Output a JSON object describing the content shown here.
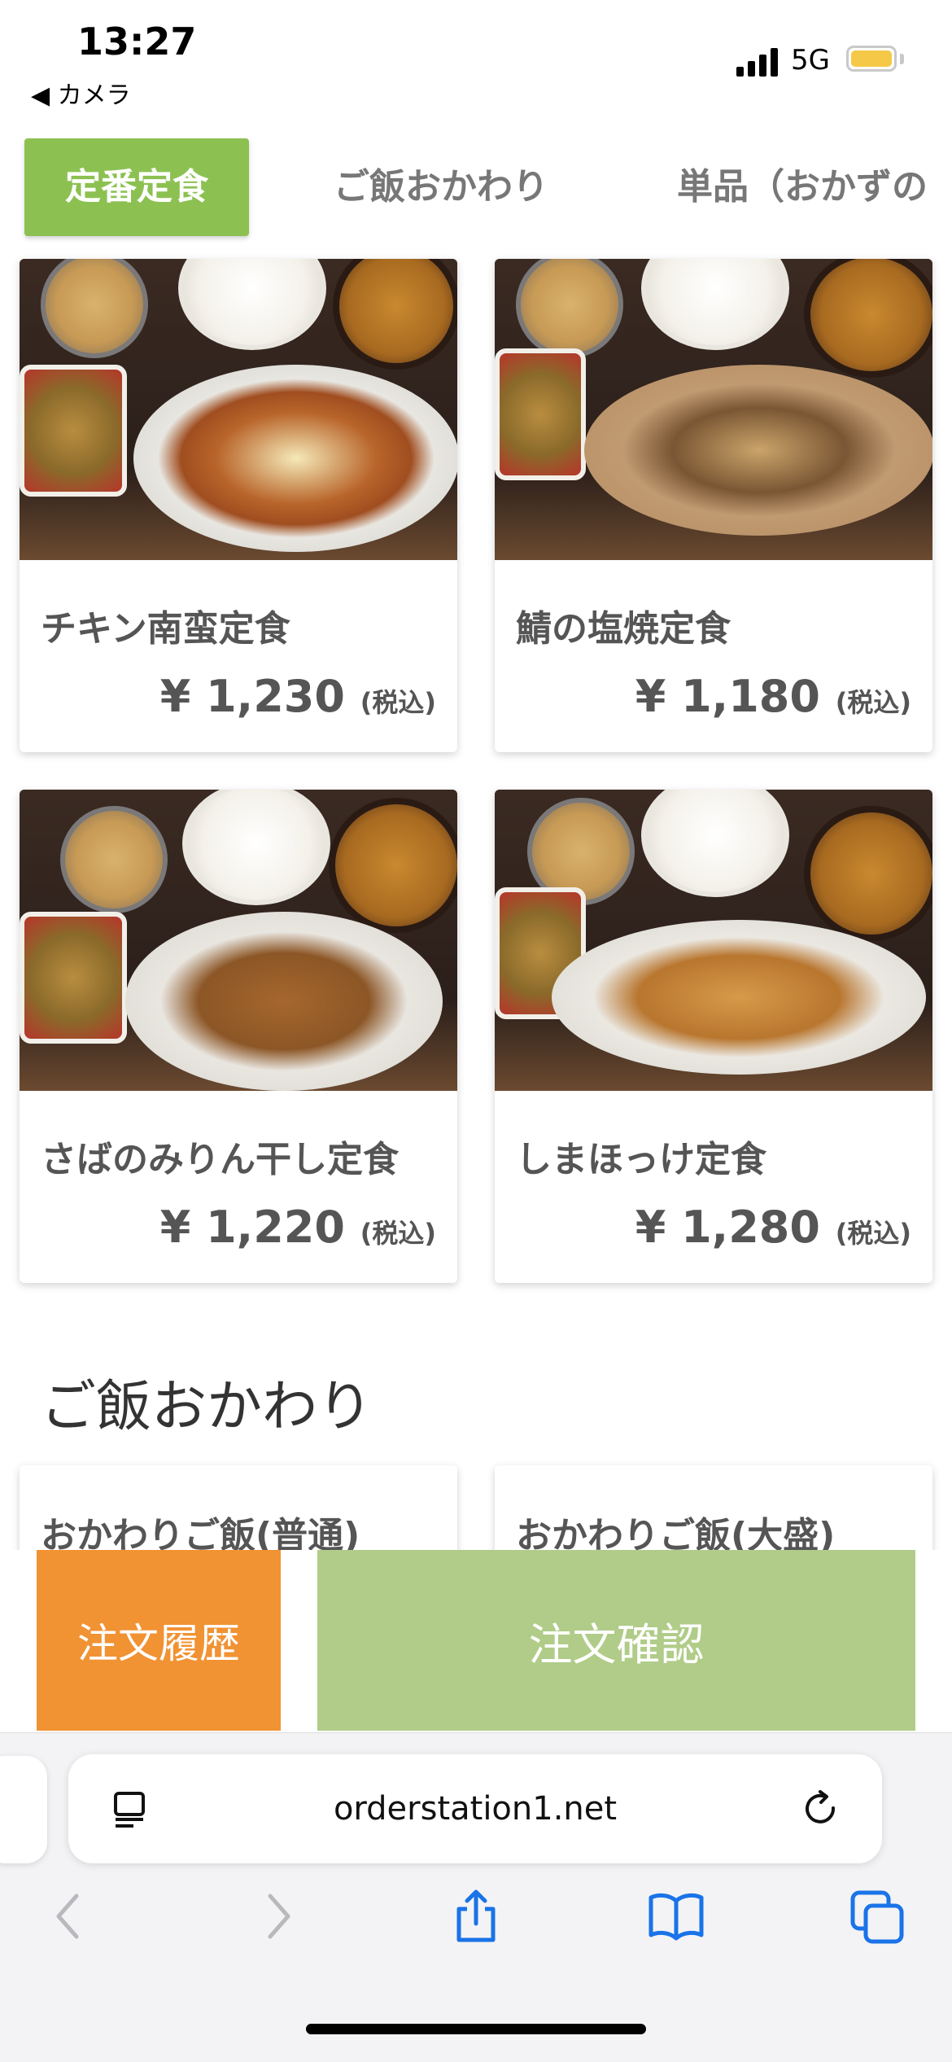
{
  "status_bar": {
    "time": "13:27",
    "back_label": "◀ カメラ",
    "network": "5G"
  },
  "tabs": [
    {
      "label": "定番定食",
      "active": true
    },
    {
      "label": "ご飯おかわり",
      "active": false
    },
    {
      "label": "単品（おかずの"
    }
  ],
  "menu": {
    "items": [
      {
        "name": "チキン南蛮定食",
        "price": "¥ 1,230",
        "tax": "(税込)"
      },
      {
        "name": "鯖の塩焼定食",
        "price": "¥ 1,180",
        "tax": "(税込)"
      },
      {
        "name": "さばのみりん干し定食",
        "price": "¥ 1,220",
        "tax": "(税込)"
      },
      {
        "name": "しまほっけ定食",
        "price": "¥ 1,280",
        "tax": "(税込)"
      }
    ]
  },
  "section": {
    "title": "ご飯おかわり",
    "items": [
      {
        "name": "おかわりご飯(普通)"
      },
      {
        "name": "おかわりご飯(大盛)"
      }
    ]
  },
  "order_bar": {
    "history_label": "注文履歴",
    "confirm_label": "注文確認"
  },
  "browser": {
    "url": "orderstation1.net"
  },
  "colors": {
    "accent_green": "#8cc152",
    "history_orange": "#f19233",
    "confirm_green": "#b0cc88",
    "link_blue": "#1a73e8"
  }
}
